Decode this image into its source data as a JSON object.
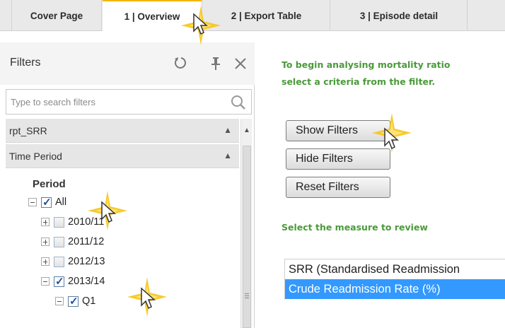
{
  "tabs": [
    {
      "label": "Cover Page"
    },
    {
      "label": "1 | Overview"
    },
    {
      "label": "2 | Export Table"
    },
    {
      "label": "3 | Episode detail"
    }
  ],
  "filters": {
    "title": "Filters",
    "search_placeholder": "Type to search filters",
    "cards": [
      {
        "label": "rpt_SRR"
      },
      {
        "label": "Time Period"
      }
    ],
    "field_label": "Period",
    "tree": [
      {
        "label": "All",
        "checked": true
      },
      {
        "label": "2010/11",
        "checked": false
      },
      {
        "label": "2011/12",
        "checked": false
      },
      {
        "label": "2012/13",
        "checked": false
      },
      {
        "label": "2013/14",
        "checked": true
      },
      {
        "label": "Q1",
        "checked": true
      }
    ]
  },
  "main": {
    "intro_line1": "To begin analysing mortality ratio",
    "intro_line2": "select a criteria from the filter.",
    "buttons": {
      "show": "Show Filters",
      "hide": "Hide Filters",
      "reset": "Reset Filters"
    },
    "measure_label": "Select the measure to review",
    "measure_options": [
      {
        "label": "SRR (Standardised Readmission"
      },
      {
        "label": "Crude Readmission Rate (%)",
        "selected": true
      }
    ]
  },
  "colors": {
    "accent_tab": "#f2b705",
    "green_text": "#4a9a3a",
    "selected_option": "#3399ff",
    "sparkle": "#f5c518"
  }
}
